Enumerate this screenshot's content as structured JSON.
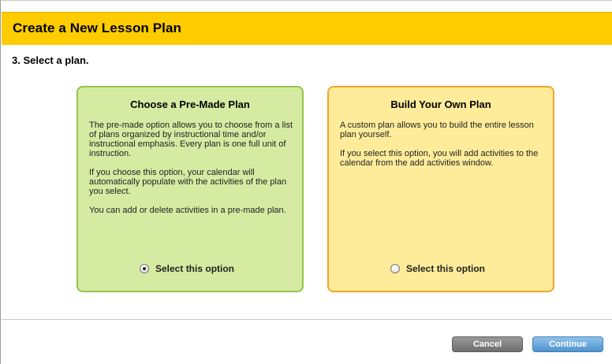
{
  "dialog": {
    "title": "Create a New Lesson Plan",
    "step_title": "3. Select a plan.",
    "header_color": "#ffcc00"
  },
  "options": [
    {
      "title": "Choose a Pre-Made Plan",
      "paragraphs": [
        "The pre-made option allows you to choose from a list of plans organized by instructional time and/or instructional emphasis. Every plan is one full unit of instruction.",
        "If you choose this option, your calendar will automatically populate with the activities of the plan you select.",
        "You can add or delete activities in a pre-made plan."
      ],
      "radio_label": "Select this option",
      "selected": true,
      "background_color": "#d6eba2",
      "border_color": "#8fc64f"
    },
    {
      "title": "Build Your Own Plan",
      "paragraphs": [
        "A custom plan allows you to build the entire lesson plan yourself.",
        "If you select this option, you will add activities to the calendar from the add activities window."
      ],
      "radio_label": "Select this option",
      "selected": false,
      "background_color": "#ffec9a",
      "border_color": "#f3a42c"
    }
  ],
  "footer": {
    "cancel_label": "Cancel",
    "continue_label": "Continue"
  }
}
